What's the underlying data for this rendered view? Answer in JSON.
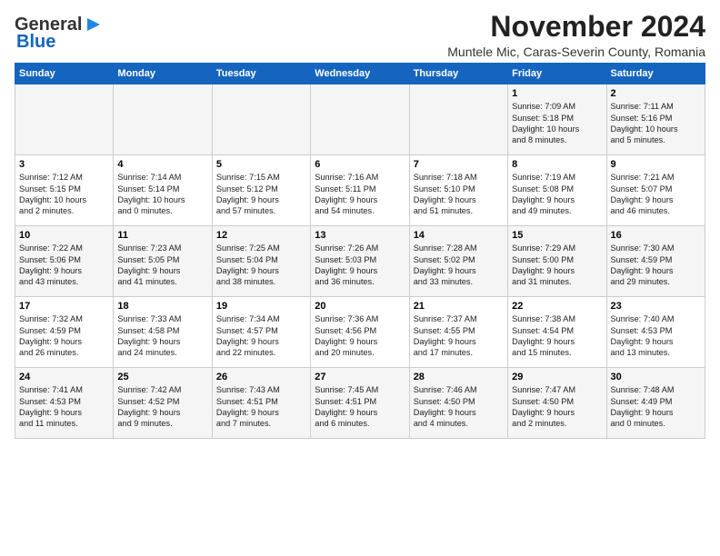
{
  "logo": {
    "line1": "General",
    "line2": "Blue"
  },
  "header": {
    "month": "November 2024",
    "location": "Muntele Mic, Caras-Severin County, Romania"
  },
  "weekdays": [
    "Sunday",
    "Monday",
    "Tuesday",
    "Wednesday",
    "Thursday",
    "Friday",
    "Saturday"
  ],
  "weeks": [
    [
      {
        "day": "",
        "info": ""
      },
      {
        "day": "",
        "info": ""
      },
      {
        "day": "",
        "info": ""
      },
      {
        "day": "",
        "info": ""
      },
      {
        "day": "",
        "info": ""
      },
      {
        "day": "1",
        "info": "Sunrise: 7:09 AM\nSunset: 5:18 PM\nDaylight: 10 hours\nand 8 minutes."
      },
      {
        "day": "2",
        "info": "Sunrise: 7:11 AM\nSunset: 5:16 PM\nDaylight: 10 hours\nand 5 minutes."
      }
    ],
    [
      {
        "day": "3",
        "info": "Sunrise: 7:12 AM\nSunset: 5:15 PM\nDaylight: 10 hours\nand 2 minutes."
      },
      {
        "day": "4",
        "info": "Sunrise: 7:14 AM\nSunset: 5:14 PM\nDaylight: 10 hours\nand 0 minutes."
      },
      {
        "day": "5",
        "info": "Sunrise: 7:15 AM\nSunset: 5:12 PM\nDaylight: 9 hours\nand 57 minutes."
      },
      {
        "day": "6",
        "info": "Sunrise: 7:16 AM\nSunset: 5:11 PM\nDaylight: 9 hours\nand 54 minutes."
      },
      {
        "day": "7",
        "info": "Sunrise: 7:18 AM\nSunset: 5:10 PM\nDaylight: 9 hours\nand 51 minutes."
      },
      {
        "day": "8",
        "info": "Sunrise: 7:19 AM\nSunset: 5:08 PM\nDaylight: 9 hours\nand 49 minutes."
      },
      {
        "day": "9",
        "info": "Sunrise: 7:21 AM\nSunset: 5:07 PM\nDaylight: 9 hours\nand 46 minutes."
      }
    ],
    [
      {
        "day": "10",
        "info": "Sunrise: 7:22 AM\nSunset: 5:06 PM\nDaylight: 9 hours\nand 43 minutes."
      },
      {
        "day": "11",
        "info": "Sunrise: 7:23 AM\nSunset: 5:05 PM\nDaylight: 9 hours\nand 41 minutes."
      },
      {
        "day": "12",
        "info": "Sunrise: 7:25 AM\nSunset: 5:04 PM\nDaylight: 9 hours\nand 38 minutes."
      },
      {
        "day": "13",
        "info": "Sunrise: 7:26 AM\nSunset: 5:03 PM\nDaylight: 9 hours\nand 36 minutes."
      },
      {
        "day": "14",
        "info": "Sunrise: 7:28 AM\nSunset: 5:02 PM\nDaylight: 9 hours\nand 33 minutes."
      },
      {
        "day": "15",
        "info": "Sunrise: 7:29 AM\nSunset: 5:00 PM\nDaylight: 9 hours\nand 31 minutes."
      },
      {
        "day": "16",
        "info": "Sunrise: 7:30 AM\nSunset: 4:59 PM\nDaylight: 9 hours\nand 29 minutes."
      }
    ],
    [
      {
        "day": "17",
        "info": "Sunrise: 7:32 AM\nSunset: 4:59 PM\nDaylight: 9 hours\nand 26 minutes."
      },
      {
        "day": "18",
        "info": "Sunrise: 7:33 AM\nSunset: 4:58 PM\nDaylight: 9 hours\nand 24 minutes."
      },
      {
        "day": "19",
        "info": "Sunrise: 7:34 AM\nSunset: 4:57 PM\nDaylight: 9 hours\nand 22 minutes."
      },
      {
        "day": "20",
        "info": "Sunrise: 7:36 AM\nSunset: 4:56 PM\nDaylight: 9 hours\nand 20 minutes."
      },
      {
        "day": "21",
        "info": "Sunrise: 7:37 AM\nSunset: 4:55 PM\nDaylight: 9 hours\nand 17 minutes."
      },
      {
        "day": "22",
        "info": "Sunrise: 7:38 AM\nSunset: 4:54 PM\nDaylight: 9 hours\nand 15 minutes."
      },
      {
        "day": "23",
        "info": "Sunrise: 7:40 AM\nSunset: 4:53 PM\nDaylight: 9 hours\nand 13 minutes."
      }
    ],
    [
      {
        "day": "24",
        "info": "Sunrise: 7:41 AM\nSunset: 4:53 PM\nDaylight: 9 hours\nand 11 minutes."
      },
      {
        "day": "25",
        "info": "Sunrise: 7:42 AM\nSunset: 4:52 PM\nDaylight: 9 hours\nand 9 minutes."
      },
      {
        "day": "26",
        "info": "Sunrise: 7:43 AM\nSunset: 4:51 PM\nDaylight: 9 hours\nand 7 minutes."
      },
      {
        "day": "27",
        "info": "Sunrise: 7:45 AM\nSunset: 4:51 PM\nDaylight: 9 hours\nand 6 minutes."
      },
      {
        "day": "28",
        "info": "Sunrise: 7:46 AM\nSunset: 4:50 PM\nDaylight: 9 hours\nand 4 minutes."
      },
      {
        "day": "29",
        "info": "Sunrise: 7:47 AM\nSunset: 4:50 PM\nDaylight: 9 hours\nand 2 minutes."
      },
      {
        "day": "30",
        "info": "Sunrise: 7:48 AM\nSunset: 4:49 PM\nDaylight: 9 hours\nand 0 minutes."
      }
    ]
  ]
}
